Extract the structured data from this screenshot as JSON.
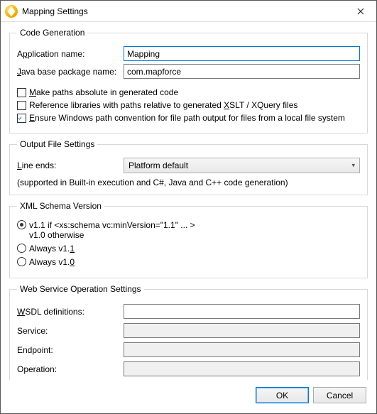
{
  "window": {
    "title": "Mapping Settings",
    "icon": "mapforce-icon"
  },
  "codegen": {
    "legend": "Code Generation",
    "app_name_label_pre": "A",
    "app_name_label_u": "p",
    "app_name_label_post": "plication name:",
    "app_name_value": "Mapping",
    "java_pkg_label_pre": "",
    "java_pkg_label_u": "J",
    "java_pkg_label_post": "ava base package name:",
    "java_pkg_value": "com.mapforce",
    "cb1_pre": "",
    "cb1_u": "M",
    "cb1_post": "ake paths absolute in generated code",
    "cb1_checked": false,
    "cb2_pre": "Reference libraries with paths relative to generated ",
    "cb2_u": "X",
    "cb2_post": "SLT / XQuery files",
    "cb2_checked": false,
    "cb3_pre": "",
    "cb3_u": "E",
    "cb3_post": "nsure Windows path convention for file path output for files from a local file system",
    "cb3_checked": true
  },
  "output": {
    "legend": "Output File Settings",
    "line_ends_pre": "",
    "line_ends_u": "L",
    "line_ends_post": "ine ends:",
    "line_ends_value": "Platform default",
    "note": "(supported in Built-in execution and C#, Java and C++ code generation)"
  },
  "schema": {
    "legend": "XML Schema Version",
    "r1_line1": "v1.1 if <xs:schema vc:minVersion=\"1.1\" ... >",
    "r1_line2": "v1.0 otherwise",
    "r2_pre": "Always v1.",
    "r2_u": "1",
    "r2_post": "",
    "r3_pre": "Always v1.",
    "r3_u": "0",
    "r3_post": "",
    "selected": 0
  },
  "webservice": {
    "legend": "Web Service Operation Settings",
    "wsdl_pre": "",
    "wsdl_u": "W",
    "wsdl_post": "SDL definitions:",
    "wsdl_value": "",
    "service_label": "Service:",
    "service_value": "",
    "endpoint_label": "Endpoint:",
    "endpoint_value": "",
    "operation_label": "Operation:",
    "operation_value": ""
  },
  "buttons": {
    "ok": "OK",
    "cancel": "Cancel"
  }
}
